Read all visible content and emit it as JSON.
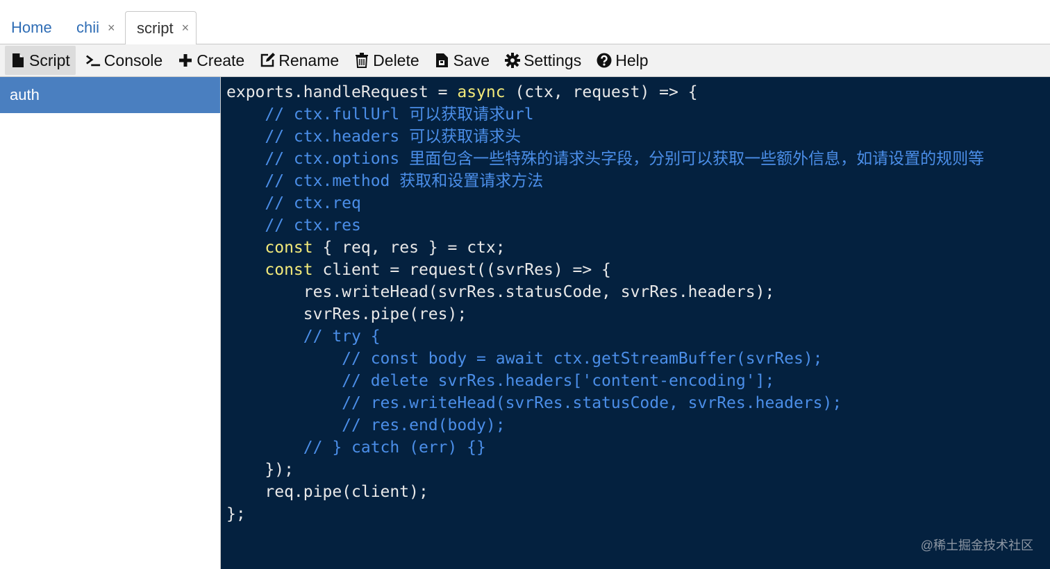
{
  "tabs": [
    {
      "label": "Home",
      "closable": false
    },
    {
      "label": "chii",
      "closable": true
    },
    {
      "label": "script",
      "closable": true,
      "active": true
    }
  ],
  "close_glyph": "×",
  "toolbar": {
    "items": [
      {
        "label": "Script",
        "icon": "file-icon",
        "active": true
      },
      {
        "label": "Console",
        "icon": "terminal-icon"
      },
      {
        "label": "Create",
        "icon": "plus-icon"
      },
      {
        "label": "Rename",
        "icon": "edit-icon"
      },
      {
        "label": "Delete",
        "icon": "trash-icon"
      },
      {
        "label": "Save",
        "icon": "save-file-icon"
      },
      {
        "label": "Settings",
        "icon": "gear-icon"
      },
      {
        "label": "Help",
        "icon": "help-icon"
      }
    ]
  },
  "sidebar": {
    "items": [
      {
        "label": "auth",
        "selected": true
      }
    ]
  },
  "editor": {
    "lines": [
      "exports.handleRequest = async (ctx, request) => {",
      "    // ctx.fullUrl 可以获取请求url",
      "    // ctx.headers 可以获取请求头",
      "    // ctx.options 里面包含一些特殊的请求头字段，分别可以获取一些额外信息，如请设置的规则等",
      "    // ctx.method 获取和设置请求方法",
      "    // ctx.req",
      "    // ctx.res",
      "    const { req, res } = ctx;",
      "    const client = request((svrRes) => {",
      "        res.writeHead(svrRes.statusCode, svrRes.headers);",
      "        svrRes.pipe(res);",
      "        // try {",
      "            // const body = await ctx.getStreamBuffer(svrRes);",
      "            // delete svrRes.headers['content-encoding'];",
      "            // res.writeHead(svrRes.statusCode, svrRes.headers);",
      "            // res.end(body);",
      "        // } catch (err) {}",
      "    });",
      "    req.pipe(client);",
      "};"
    ]
  },
  "watermark": "@稀土掘金技术社区",
  "colors": {
    "editor_bg": "#04213f",
    "keyword": "#f3ea7a",
    "comment": "#4b8ee8",
    "sidebar_selected": "#4a7fc0",
    "tab_link": "#2f6db5"
  }
}
